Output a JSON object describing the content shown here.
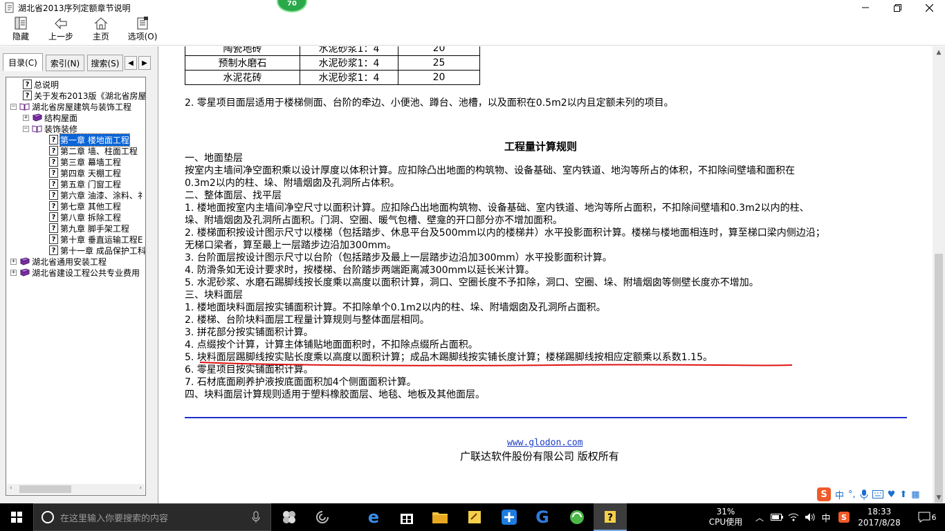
{
  "window": {
    "title": "湖北省2013序列定额章节说明",
    "badge": "70"
  },
  "toolbar": {
    "hide_label": "隐藏",
    "back_label": "上一步",
    "home_label": "主页",
    "options_label": "选项(O)"
  },
  "nav_tabs": {
    "contents": "目录(C)",
    "index": "索引(N)",
    "search": "搜索(S)"
  },
  "tree": [
    {
      "label": "总说明",
      "icon": "help-topic-icon"
    },
    {
      "label": "关于发布2013版《湖北省房屋",
      "icon": "help-topic-icon"
    },
    {
      "label": "湖北省房屋建筑与装饰工程",
      "icon": "open-book-icon",
      "expander": "−"
    },
    {
      "label": "结构屋面",
      "icon": "closed-book-icon",
      "expander": "+"
    },
    {
      "label": "装饰装修",
      "icon": "open-book-icon",
      "expander": "−"
    },
    {
      "label": "第一章 楼地面工程",
      "icon": "help-topic-icon",
      "selected": true
    },
    {
      "label": "第二章 墙、柱面工程",
      "icon": "help-topic-icon"
    },
    {
      "label": "第三章 幕墙工程",
      "icon": "help-topic-icon"
    },
    {
      "label": "第四章 天棚工程",
      "icon": "help-topic-icon"
    },
    {
      "label": "第五章 门窗工程",
      "icon": "help-topic-icon"
    },
    {
      "label": "第六章 油漆、涂料、礻",
      "icon": "help-topic-icon"
    },
    {
      "label": "第七章 其他工程",
      "icon": "help-topic-icon"
    },
    {
      "label": "第八章 拆除工程",
      "icon": "help-topic-icon"
    },
    {
      "label": "第九章 脚手架工程",
      "icon": "help-topic-icon"
    },
    {
      "label": "第十章 垂直运输工程E",
      "icon": "help-topic-icon"
    },
    {
      "label": "第十一章 成品保护工科",
      "icon": "help-topic-icon"
    },
    {
      "label": "湖北省通用安装工程",
      "icon": "closed-book-icon",
      "expander": "+"
    },
    {
      "label": "湖北省建设工程公共专业费用",
      "icon": "closed-book-icon",
      "expander": "+"
    }
  ],
  "mortar_table": {
    "rows": [
      [
        "陶瓷地砖",
        "水泥砂浆1：4",
        "20"
      ],
      [
        "预制水磨石",
        "水泥砂浆1：4",
        "25"
      ],
      [
        "水泥花砖",
        "水泥砂浆1：4",
        "20"
      ]
    ]
  },
  "content": {
    "note2": "2. 零星项目面层适用于楼梯侧面、台阶的牵边、小便池、蹲台、池槽，以及面积在0.5m2以内且定额未列的项目。",
    "heading": "工程量计算规则",
    "lines": [
      "一、地面垫层",
      "按室内主墙间净空面积乘以设计厚度以体积计算。应扣除凸出地面的构筑物、设备基础、室内铁道、地沟等所占的体积，不扣除间壁墙和面积在",
      "0.3m2以内的柱、垛、附墙烟囱及孔洞所占体积。",
      "二、整体面层、找平层",
      "1. 楼地面按室内主墙间净空尺寸以面积计算。应扣除凸出地面构筑物、设备基础、室内铁道、地沟等所占面积，不扣除间壁墙和0.3m2以内的柱、",
      "垛、附墙烟囱及孔洞所占面积。门洞、空圈、暖气包槽、壁龛的开口部分亦不增加面积。",
      "2. 楼梯面积按设计图示尺寸以楼梯（包括踏步、休息平台及500mm以内的楼梯井）水平投影面积计算。楼梯与楼地面相连时，算至梯口梁内侧边沿；",
      "无梯口梁者，算至最上一层踏步边沿加300mm。",
      "3. 台阶面层按设计图示尺寸以台阶（包括踏步及最上一层踏步边沿加300mm）水平投影面积计算。",
      "4. 防滑条如无设计要求时，按楼梯、台阶踏步两端距离减300mm以延长米计算。",
      "5. 水泥砂浆、水磨石踢脚线按长度乘以高度以面积计算，洞口、空圈长度不予扣除，洞口、空圈、垛、附墙烟囱等侧壁长度亦不增加。",
      "三、块料面层",
      "1. 楼地面块料面层按实铺面积计算。不扣除单个0.1m2以内的柱、垛、附墙烟囱及孔洞所占面积。",
      "2. 楼梯、台阶块料面层工程量计算规则与整体面层相同。",
      "3. 拼花部分按实铺面积计算。",
      "4. 点缀按个计算，计算主体铺贴地面面积时，不扣除点缀所占面积。",
      "5. 块料面层踢脚线按实贴长度乘以高度以面积计算；成品木踢脚线按实铺长度计算；楼梯踢脚线按相应定额乘以系数1.15。",
      "6. 零星项目按实铺面积计算。",
      "7. 石材底面刷养护液按底面面积加4个侧面面积计算。",
      "四、块料面层计算规则适用于塑料橡胶面层、地毯、地板及其他面层。"
    ],
    "link": "www.glodon.com",
    "copyright": "广联达软件股份有限公司 版权所有"
  },
  "ime_bar": {
    "lang": "中"
  },
  "taskbar": {
    "search_placeholder": "在这里输入你要搜索的内容",
    "cpu_percent": "31%",
    "cpu_label": "CPU使用",
    "ime_lang": "中",
    "time": "18:33",
    "date": "2017/8/28",
    "notification_count": "6"
  },
  "colors": {
    "selection": "#0a64d8",
    "divider_line": "#1e2cc8",
    "annotation_line": "#e01010",
    "link": "#1a3cc4"
  }
}
